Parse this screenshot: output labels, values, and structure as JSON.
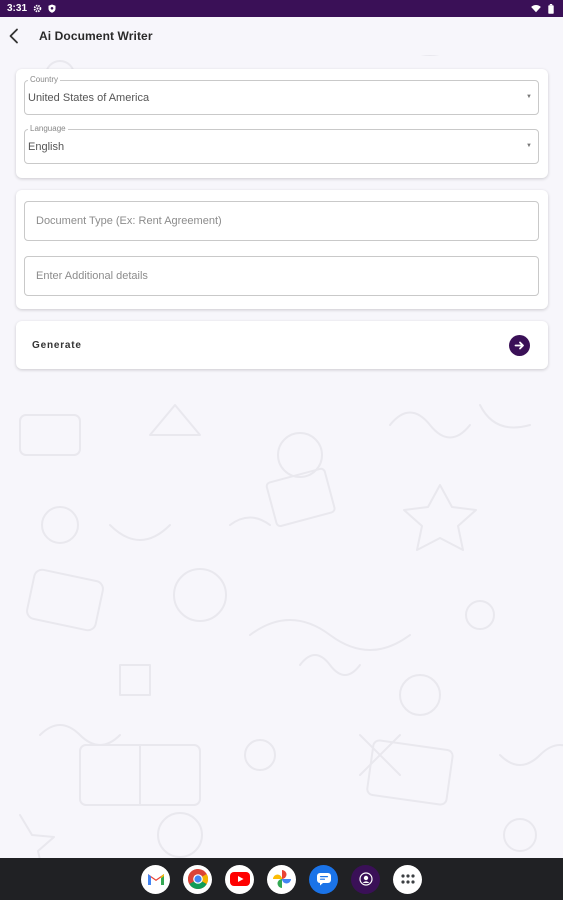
{
  "status_bar": {
    "time": "3:31",
    "left_icons": [
      "gear-icon",
      "shield-icon"
    ],
    "right_icons": [
      "wifi-icon",
      "battery-icon"
    ]
  },
  "app_bar": {
    "title": "Ai Document Writer",
    "back_icon": "back-arrow-icon"
  },
  "settings_card": {
    "country": {
      "label": "Country",
      "value": "United States of America"
    },
    "language": {
      "label": "Language",
      "value": "English"
    }
  },
  "document_card": {
    "doc_type": {
      "value": "",
      "placeholder": "Document Type (Ex: Rent Agreement)"
    },
    "details": {
      "value": "",
      "placeholder": "Enter Additional details"
    }
  },
  "generate": {
    "label": "Generate",
    "icon": "arrow-right-icon"
  },
  "taskbar": {
    "apps": [
      "gmail-icon",
      "chrome-icon",
      "youtube-icon",
      "photos-icon",
      "messages-icon",
      "assistant-app-icon",
      "app-launcher-icon"
    ]
  },
  "colors": {
    "accent": "#3a1057",
    "background": "#f7f6fb",
    "card": "#ffffff",
    "taskbar": "#202124"
  }
}
